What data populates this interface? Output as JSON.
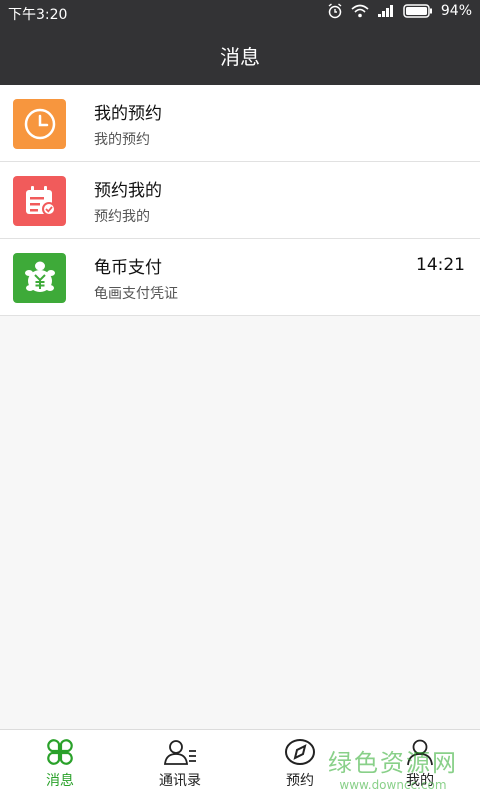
{
  "status": {
    "time": "下午3:20",
    "battery": "94%"
  },
  "header": {
    "title": "消息"
  },
  "messages": [
    {
      "title": "我的预约",
      "subtitle": "我的预约",
      "time": "",
      "icon": "clock-icon",
      "color": "#f7963e"
    },
    {
      "title": "预约我的",
      "subtitle": "预约我的",
      "time": "",
      "icon": "calendar-check-icon",
      "color": "#f15b5b"
    },
    {
      "title": "龟币支付",
      "subtitle": "龟画支付凭证",
      "time": "14:21",
      "icon": "turtle-yuan-icon",
      "color": "#3eaa39"
    }
  ],
  "tabs": [
    {
      "label": "消息",
      "icon": "clover-icon",
      "active": true
    },
    {
      "label": "通讯录",
      "icon": "contacts-icon",
      "active": false
    },
    {
      "label": "预约",
      "icon": "compass-icon",
      "active": false
    },
    {
      "label": "我的",
      "icon": "person-icon",
      "active": false
    }
  ],
  "watermark": {
    "text": "绿色资源网",
    "url": "www.downcc.com"
  },
  "colors": {
    "accent": "#2aa12a",
    "bar": "#333335"
  }
}
